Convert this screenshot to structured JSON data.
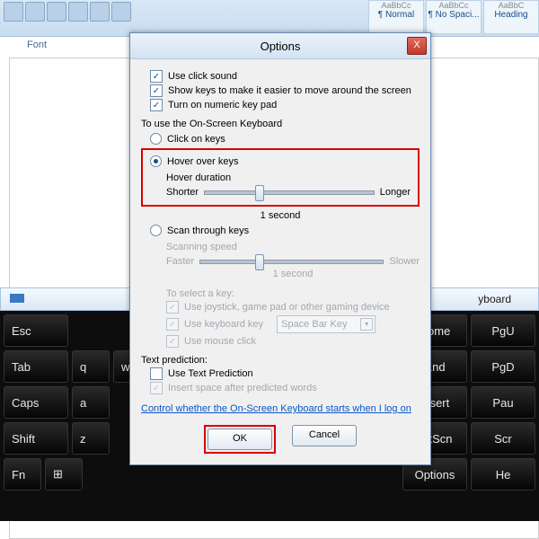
{
  "ribbon": {
    "group_label": "Font",
    "styles": [
      {
        "sample": "AaBbCc",
        "label": "¶ Normal"
      },
      {
        "sample": "AaBbCc",
        "label": "¶ No Spaci..."
      },
      {
        "sample": "AaBbC",
        "label": "Heading"
      }
    ]
  },
  "osk": {
    "title_suffix": "yboard",
    "rows_left": [
      [
        "Esc"
      ],
      [
        "Tab",
        "q",
        "w"
      ],
      [
        "Caps",
        "a"
      ],
      [
        "Shift",
        "z"
      ],
      [
        "Fn",
        "⊞"
      ]
    ],
    "rows_right": [
      [
        "Home",
        "PgU"
      ],
      [
        "End",
        "PgD"
      ],
      [
        "Insert",
        "Pau"
      ],
      [
        "PrtScn",
        "Scr"
      ],
      [
        "Options",
        "He"
      ]
    ]
  },
  "dialog": {
    "title": "Options",
    "close_glyph": "X",
    "checks": {
      "click_sound": "Use click sound",
      "show_keys": "Show keys to make it easier to move around the screen",
      "numeric": "Turn on numeric key pad"
    },
    "to_use": "To use the On-Screen Keyboard",
    "radios": {
      "click": "Click on keys",
      "hover": "Hover over keys",
      "scan": "Scan through keys"
    },
    "hover": {
      "duration_label": "Hover duration",
      "shorter": "Shorter",
      "longer": "Longer",
      "caption": "1 second"
    },
    "scan": {
      "speed_label": "Scanning speed",
      "faster": "Faster",
      "slower": "Slower",
      "caption": "1 second",
      "select_label": "To select a key:",
      "joystick": "Use joystick, game pad or other gaming device",
      "kbkey": "Use keyboard key",
      "kbkey_combo": "Space Bar Key",
      "mouse": "Use mouse click"
    },
    "text_prediction": {
      "heading": "Text prediction:",
      "use": "Use Text Prediction",
      "space": "Insert space after predicted words"
    },
    "link": "Control whether the On-Screen Keyboard starts when I log on",
    "buttons": {
      "ok": "OK",
      "cancel": "Cancel"
    }
  }
}
